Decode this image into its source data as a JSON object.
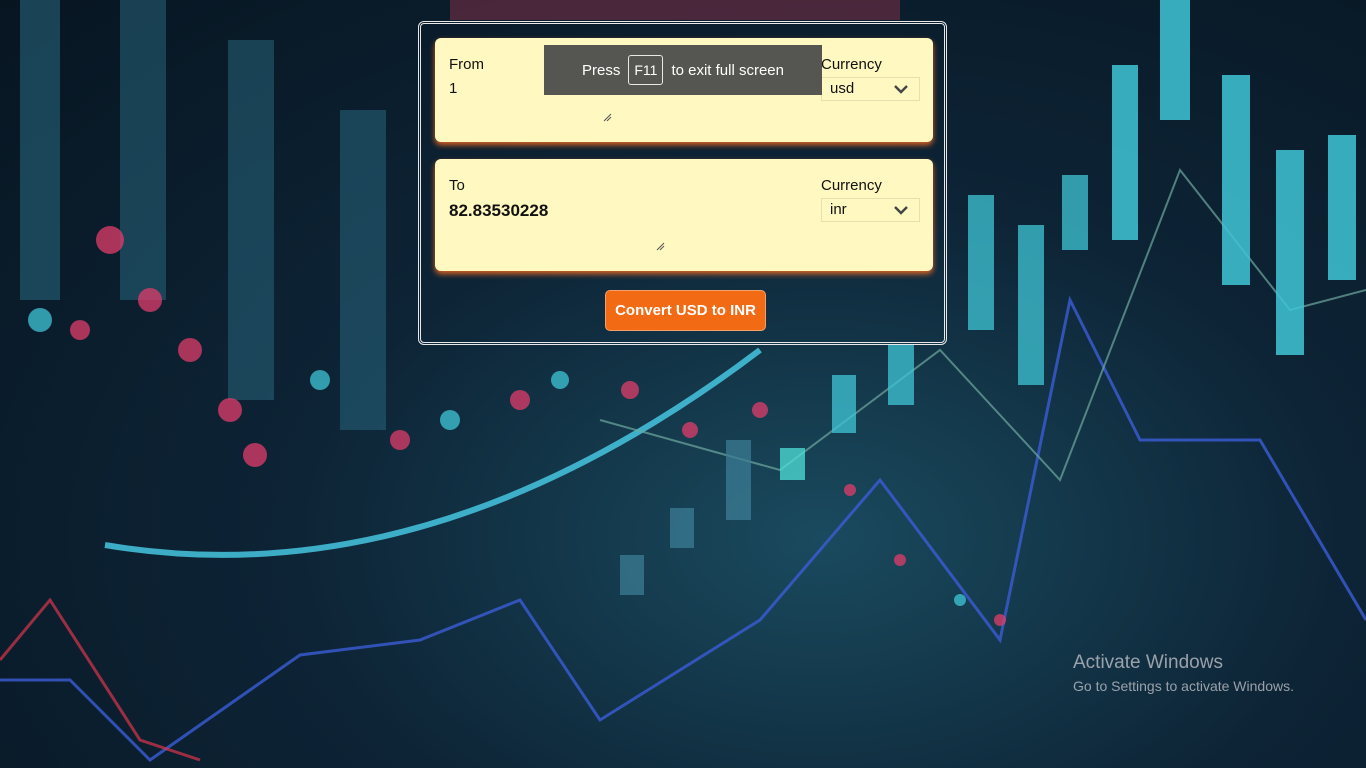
{
  "from": {
    "label": "From",
    "value": "1",
    "currency_label": "Currency",
    "currency": "usd"
  },
  "to": {
    "label": "To",
    "value": "82.83530228",
    "currency_label": "Currency",
    "currency": "inr"
  },
  "convert_button": "Convert USD to INR",
  "fullscreen_notice": {
    "press": "Press",
    "key": "F11",
    "suffix": "to exit full screen"
  },
  "watermark": {
    "title": "Activate Windows",
    "subtitle": "Go to Settings to activate Windows."
  },
  "colors": {
    "panel": "#fff8c0",
    "accent": "#f26a14",
    "background": "#0d2436"
  },
  "icons": [
    "chevron-down-icon",
    "resize-grip-icon"
  ]
}
